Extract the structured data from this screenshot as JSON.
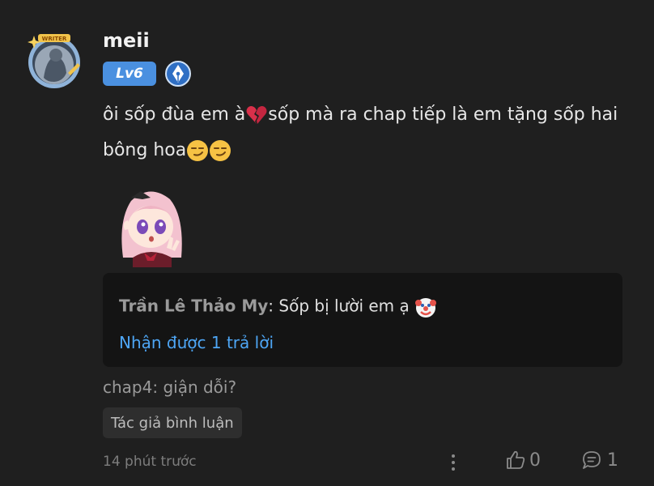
{
  "user": {
    "name": "meii",
    "level": "Lv6",
    "avatar_badge": "WRITER",
    "icons": [
      "writer-avatar-icon",
      "pen-nib-icon"
    ]
  },
  "comment": {
    "part1": "ôi sốp đùa em à",
    "part2": "sốp mà ra chap tiếp là em tặng sốp hai bông hoa",
    "emojis": [
      "broken-heart-icon",
      "smirk-face-icon",
      "smirk-face-icon"
    ]
  },
  "sticker": {
    "name": "anime-girl-sticker"
  },
  "reply": {
    "author": "Trần Lê Thảo My",
    "text": ": Sốp bị lười em ạ",
    "emoji": "clown-face-icon",
    "count_text": "Nhận được 1 trả lời"
  },
  "chapter": "chap4: giận dỗi?",
  "author_tag": "Tác giả bình luận",
  "footer": {
    "time": "14 phút trước",
    "likes": "0",
    "replies": "1"
  },
  "colors": {
    "background": "#1f1f1f",
    "reply_box": "#141414",
    "level_badge": "#4a90e0",
    "link": "#4ea6f5"
  }
}
